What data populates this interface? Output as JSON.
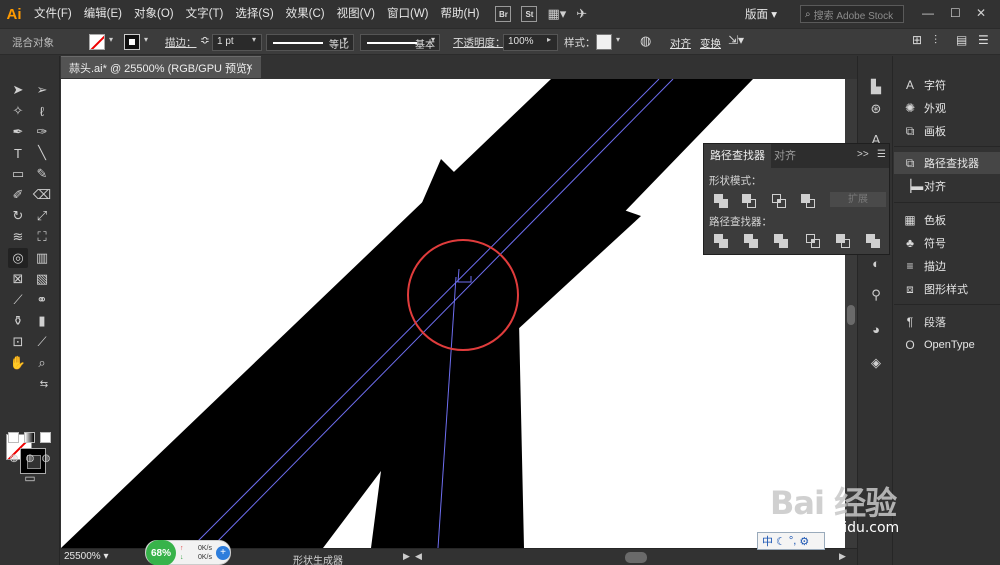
{
  "menu": {
    "app_logo": "Ai",
    "items": [
      "文件(F)",
      "编辑(E)",
      "对象(O)",
      "文字(T)",
      "选择(S)",
      "效果(C)",
      "视图(V)",
      "窗口(W)",
      "帮助(H)"
    ],
    "bridge": "Br",
    "stock": "St",
    "workspace": "版面",
    "search_placeholder": "搜索 Adobe Stock",
    "window_controls": [
      "—",
      "☐",
      "✕"
    ]
  },
  "control_bar": {
    "selection_label": "混合对象",
    "stroke_label": "描边：",
    "stroke_weight": "1 pt",
    "profile": "等比",
    "brush": "基本",
    "opacity_label": "不透明度：",
    "opacity_value": "100%",
    "style_label": "样式：",
    "align_link": "对齐",
    "transform_link": "变换"
  },
  "document": {
    "tab_title": "蒜头.ai* @ 25500% (RGB/GPU 预览)",
    "close": "×"
  },
  "status_bar": {
    "zoom": "25500%",
    "tool_name": "形状生成器"
  },
  "perf_widget": {
    "percent": "68%",
    "up_rate": "0K/s",
    "down_rate": "0K/s"
  },
  "right_panel": {
    "items": [
      {
        "icon": "character-icon",
        "label": "字符"
      },
      {
        "icon": "appearance-icon",
        "label": "外观"
      },
      {
        "icon": "artboards-icon",
        "label": "画板"
      },
      {
        "icon": "pathfinder-icon",
        "label": "路径查找器"
      },
      {
        "icon": "align-icon",
        "label": "对齐"
      },
      {
        "icon": "swatches-icon",
        "label": "色板"
      },
      {
        "icon": "symbols-icon",
        "label": "符号"
      },
      {
        "icon": "stroke-icon",
        "label": "描边"
      },
      {
        "icon": "graphic-styles-icon",
        "label": "图形样式"
      },
      {
        "icon": "paragraph-icon",
        "label": "段落"
      },
      {
        "icon": "opentype-icon",
        "label": "OpenType"
      }
    ]
  },
  "pathfinder_panel": {
    "tab_active": "路径查找器",
    "tab_inactive": "对齐",
    "collapse": ">>",
    "shape_modes_label": "形状模式：",
    "pathfinders_label": "路径查找器：",
    "expand_button": "扩展"
  },
  "watermark": {
    "text": "Bai 经验",
    "url": "jingyan.baidu.com"
  },
  "ime": {
    "mode": "中"
  }
}
